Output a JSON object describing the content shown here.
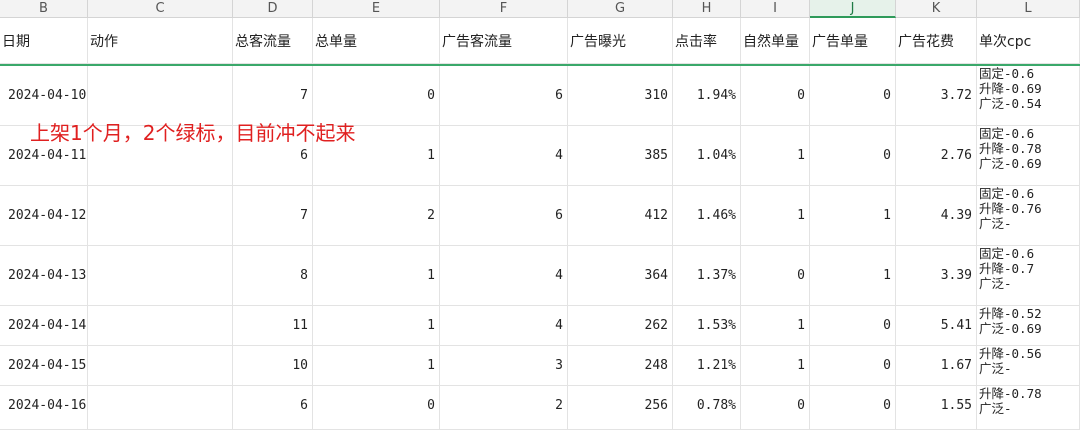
{
  "column_letters": [
    "B",
    "C",
    "D",
    "E",
    "F",
    "G",
    "H",
    "I",
    "J",
    "K",
    "L"
  ],
  "active_column": "J",
  "headers": [
    "日期",
    "动作",
    "总客流量",
    "总单量",
    "广告客流量",
    "广告曝光",
    "点击率",
    "自然单量",
    "广告单量",
    "广告花费",
    "单次cpc"
  ],
  "annotation": "上架1个月，2个绿标，目前冲不起来",
  "rows": [
    {
      "date": "2024-04-10",
      "action": "",
      "traffic": "7",
      "orders": "0",
      "ad_traffic": "6",
      "impressions": "310",
      "ctr": "1.94%",
      "organic": "0",
      "ad_orders": "0",
      "spend": "3.72",
      "cpc": "固定-0.6\n升降-0.69\n广泛-0.54"
    },
    {
      "date": "2024-04-11",
      "action": "",
      "traffic": "6",
      "orders": "1",
      "ad_traffic": "4",
      "impressions": "385",
      "ctr": "1.04%",
      "organic": "1",
      "ad_orders": "0",
      "spend": "2.76",
      "cpc": "固定-0.6\n升降-0.78\n广泛-0.69"
    },
    {
      "date": "2024-04-12",
      "action": "",
      "traffic": "7",
      "orders": "2",
      "ad_traffic": "6",
      "impressions": "412",
      "ctr": "1.46%",
      "organic": "1",
      "ad_orders": "1",
      "spend": "4.39",
      "cpc": "固定-0.6\n升降-0.76\n广泛-"
    },
    {
      "date": "2024-04-13",
      "action": "",
      "traffic": "8",
      "orders": "1",
      "ad_traffic": "4",
      "impressions": "364",
      "ctr": "1.37%",
      "organic": "0",
      "ad_orders": "1",
      "spend": "3.39",
      "cpc": "固定-0.6\n升降-0.7\n广泛-"
    },
    {
      "date": "2024-04-14",
      "action": "",
      "traffic": "11",
      "orders": "1",
      "ad_traffic": "4",
      "impressions": "262",
      "ctr": "1.53%",
      "organic": "1",
      "ad_orders": "0",
      "spend": "5.41",
      "cpc": "升降-0.52\n广泛-0.69"
    },
    {
      "date": "2024-04-15",
      "action": "",
      "traffic": "10",
      "orders": "1",
      "ad_traffic": "3",
      "impressions": "248",
      "ctr": "1.21%",
      "organic": "1",
      "ad_orders": "0",
      "spend": "1.67",
      "cpc": "升降-0.56\n广泛-"
    },
    {
      "date": "2024-04-16",
      "action": "",
      "traffic": "6",
      "orders": "0",
      "ad_traffic": "2",
      "impressions": "256",
      "ctr": "0.78%",
      "organic": "0",
      "ad_orders": "0",
      "spend": "1.55",
      "cpc": "升降-0.78\n广泛-"
    }
  ]
}
